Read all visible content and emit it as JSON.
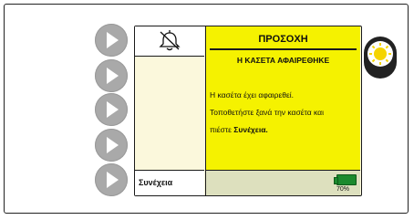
{
  "side_buttons": [
    {
      "icon": "play-triangle-icon"
    },
    {
      "icon": "play-triangle-icon"
    },
    {
      "icon": "play-triangle-icon"
    },
    {
      "icon": "play-triangle-icon"
    },
    {
      "icon": "play-triangle-icon"
    }
  ],
  "header": {
    "icon": "muted-bell-icon",
    "title": "ΠΡΟΣΟΧΗ"
  },
  "alert": {
    "subtitle": "Η ΚΑΣΕΤΑ ΑΦΑΙΡΕΘΗΚΕ",
    "line1": "Η κασέτα έχει αφαιρεθεί.",
    "line2": "Τοποθετήστε ξανά την κασέτα και",
    "line3_prefix": "πιέστε ",
    "line3_bold": "Συνέχεια."
  },
  "softkey": {
    "label": "Συνέχεια"
  },
  "battery": {
    "percent": "70%",
    "color": "#1c8a2e"
  },
  "indicator": {
    "icon": "alarm-light-icon",
    "color": "#f5d400"
  },
  "colors": {
    "screen_yellow": "#f5f200",
    "side_button": "#a9a9a9"
  }
}
